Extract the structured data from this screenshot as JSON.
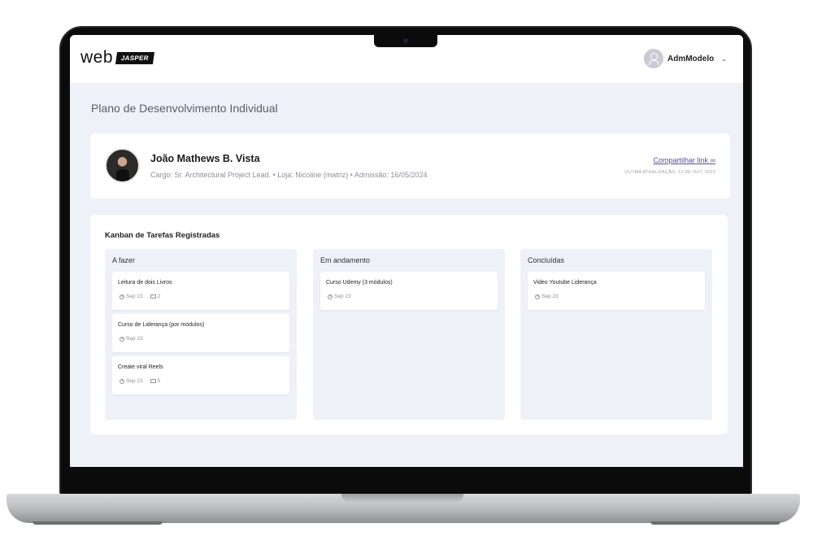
{
  "header": {
    "logo_word": "web",
    "logo_badge": "JASPER",
    "user_name": "AdmModelo"
  },
  "page": {
    "title": "Plano de Desenvolvimento Individual"
  },
  "profile": {
    "name": "João Mathews B. Vista",
    "meta": "Cargo: Sr. Architectural Project Lead. • Loja: Nicoline (matriz) • Admissão: 16/05/2024",
    "share_label": "Compartilhar link",
    "last_update": "ÚLTIMA ATUALIZAÇÃO: 12 DE OUT, 2023"
  },
  "kanban": {
    "title": "Kanban de Tarefas Registradas",
    "columns": [
      {
        "title": "A fazer",
        "tasks": [
          {
            "title": "Leitura de dois Livros",
            "date": "Sep 23",
            "count": "2"
          },
          {
            "title": "Curso de Liderança (por módulos)",
            "date": "Sep 23"
          },
          {
            "title": "Create viral Reels",
            "date": "Sep 23",
            "count": "5"
          }
        ]
      },
      {
        "title": "Em andamento",
        "tasks": [
          {
            "title": "Curso Udemy (3 módulos)",
            "date": "Sep 23"
          }
        ]
      },
      {
        "title": "Concluídas",
        "tasks": [
          {
            "title": "Video Youtube Liderança",
            "date": "Sep 23"
          }
        ]
      }
    ]
  }
}
